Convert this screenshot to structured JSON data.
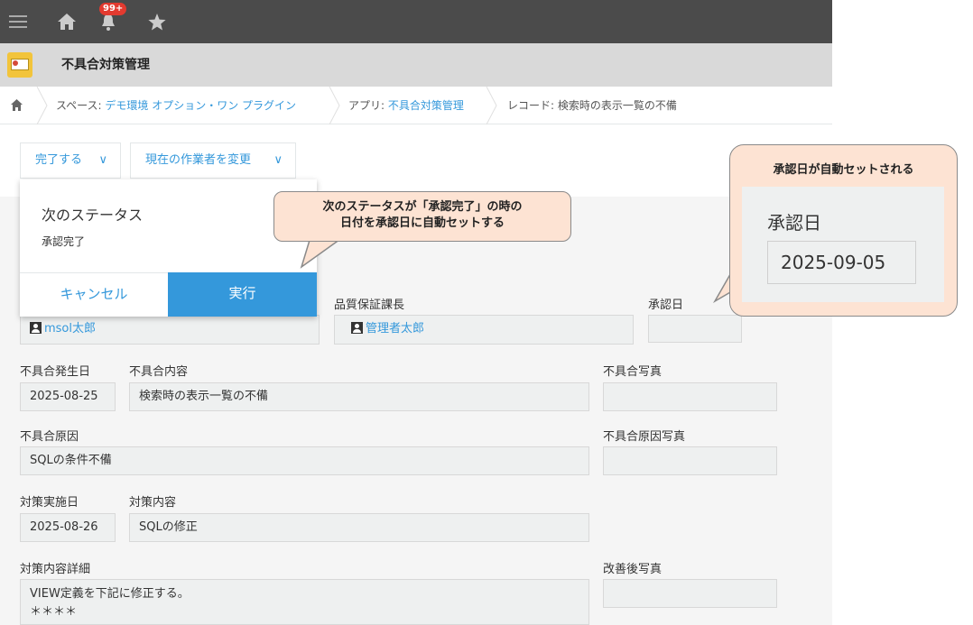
{
  "header": {
    "notification_count": "99+"
  },
  "app": {
    "title": "不具合対策管理"
  },
  "breadcrumb": {
    "space_prefix": "スペース: ",
    "space_name": "デモ環境 オプション・ワン プラグイン",
    "app_prefix": "アプリ: ",
    "app_name": "不具合対策管理",
    "record": "レコード: 検索時の表示一覧の不備"
  },
  "actions": {
    "complete": "完了する",
    "change_assignee": "現在の作業者を変更"
  },
  "popup": {
    "title": "次のステータス",
    "next_status": "承認完了",
    "cancel": "キャンセル",
    "execute": "実行"
  },
  "fields": {
    "reporter_value": "msol太郎",
    "qa_manager_label": "品質保証課長",
    "qa_manager_value": "管理者太郎",
    "approval_date_label": "承認日",
    "approval_date_value": "",
    "defect_date_label": "不具合発生日",
    "defect_date_value": "2025-08-25",
    "defect_content_label": "不具合内容",
    "defect_content_value": "検索時の表示一覧の不備",
    "defect_photo_label": "不具合写真",
    "defect_cause_label": "不具合原因",
    "defect_cause_value": "SQLの条件不備",
    "defect_cause_photo_label": "不具合原因写真",
    "action_date_label": "対策実施日",
    "action_date_value": "2025-08-26",
    "action_content_label": "対策内容",
    "action_content_value": "SQLの修正",
    "action_detail_label": "対策内容詳細",
    "action_detail_line1": "VIEW定義を下記に修正する。",
    "action_detail_line2": "＊＊＊＊",
    "improved_photo_label": "改善後写真"
  },
  "callouts": {
    "status_note_line1": "次のステータスが「承認完了」の時の",
    "status_note_line2": "日付を承認日に自動セットする",
    "auto_set_title": "承認日が自動セットされる",
    "auto_set_label": "承認日",
    "auto_set_value": "2025-09-05"
  },
  "colors": {
    "accent": "#3498db",
    "header": "#4b4b4b",
    "callout": "#fde3d3"
  }
}
